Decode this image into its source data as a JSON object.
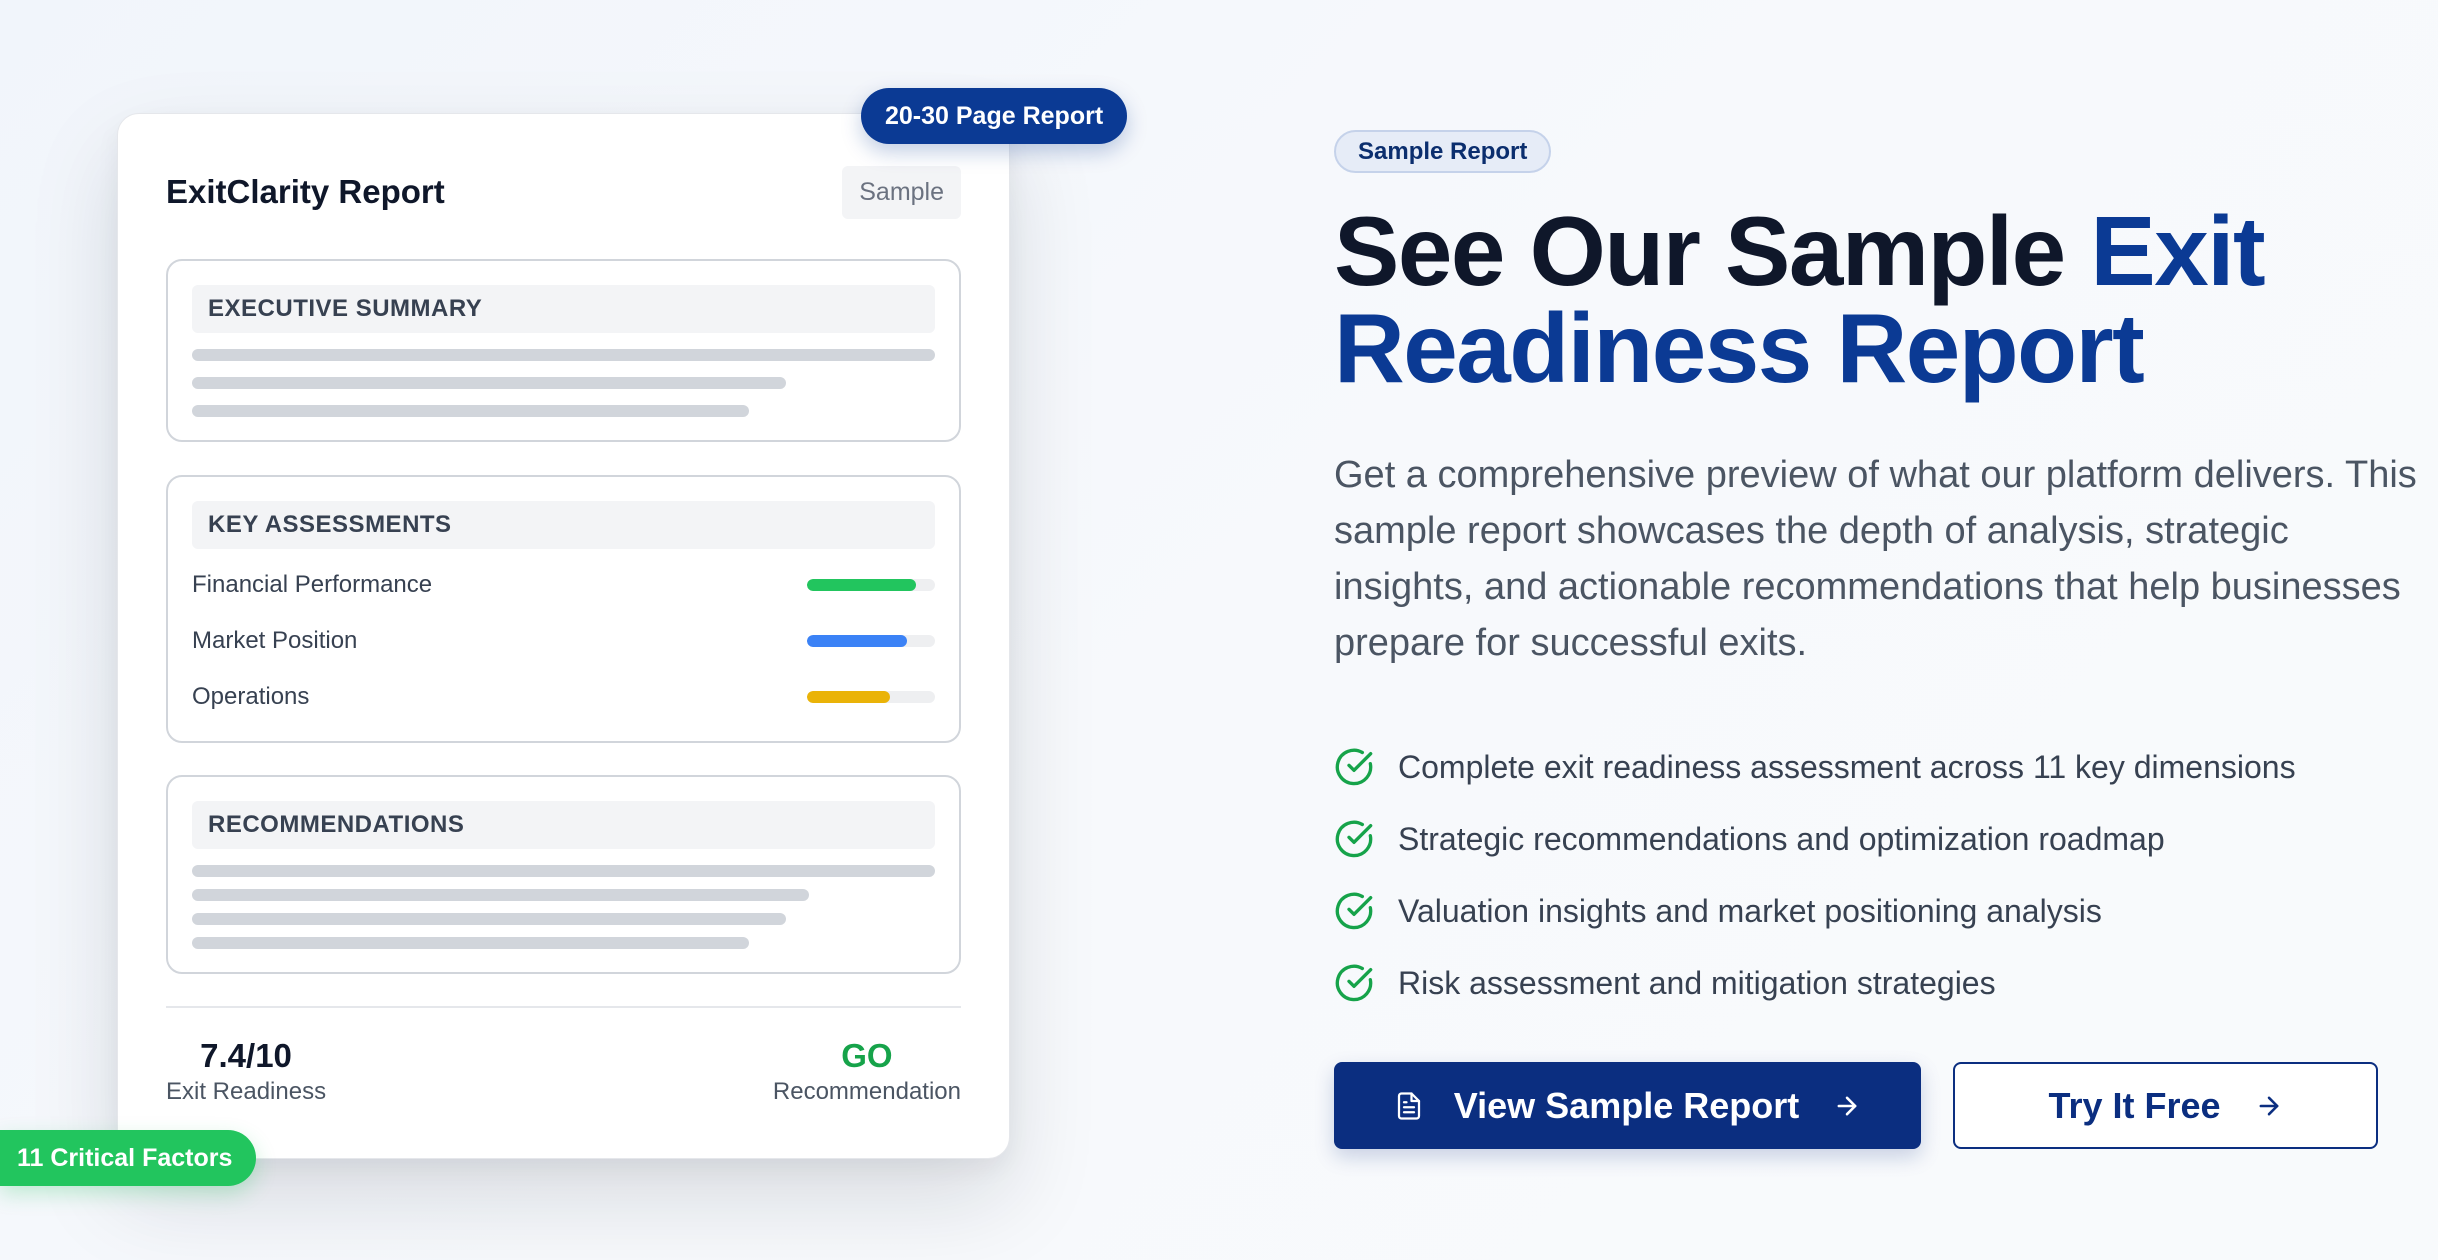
{
  "report_card": {
    "title": "ExitClarity Report",
    "tag": "Sample",
    "top_badge": "20-30 Page Report",
    "bottom_badge": "11 Critical Factors",
    "sections": {
      "executive_summary": {
        "heading": "EXECUTIVE SUMMARY"
      },
      "key_assessments": {
        "heading": "KEY ASSESSMENTS",
        "items": [
          {
            "label": "Financial Performance",
            "level": 0.85,
            "color": "#22c55e"
          },
          {
            "label": "Market Position",
            "level": 0.78,
            "color": "#3b82f6"
          },
          {
            "label": "Operations",
            "level": 0.65,
            "color": "#eab308"
          }
        ]
      },
      "recommendations": {
        "heading": "RECOMMENDATIONS"
      }
    },
    "score": {
      "value": "7.4/10",
      "label": "Exit Readiness"
    },
    "recommendation": {
      "value": "GO",
      "label": "Recommendation"
    }
  },
  "hero": {
    "pill": "Sample Report",
    "headline_main": "See Our Sample ",
    "headline_accent": "Exit Readiness Report",
    "lead": "Get a comprehensive preview of what our platform delivers. This sample report showcases the depth of analysis, strategic insights, and actionable recommendations that help businesses prepare for successful exits.",
    "features": [
      "Complete exit readiness assessment across 11 key dimensions",
      "Strategic recommendations and optimization roadmap",
      "Valuation insights and market positioning analysis",
      "Risk assessment and mitigation strategies"
    ],
    "primary_button": "View Sample Report",
    "secondary_button": "Try It Free"
  },
  "colors": {
    "brand_navy": "#0b2e80",
    "accent_blue": "#0b3a94",
    "success_green": "#22c55e",
    "go_green": "#16a34a"
  },
  "icons": {
    "feature_check": "check-circle-icon",
    "primary_button": "document-icon",
    "arrow": "arrow-right-icon"
  }
}
